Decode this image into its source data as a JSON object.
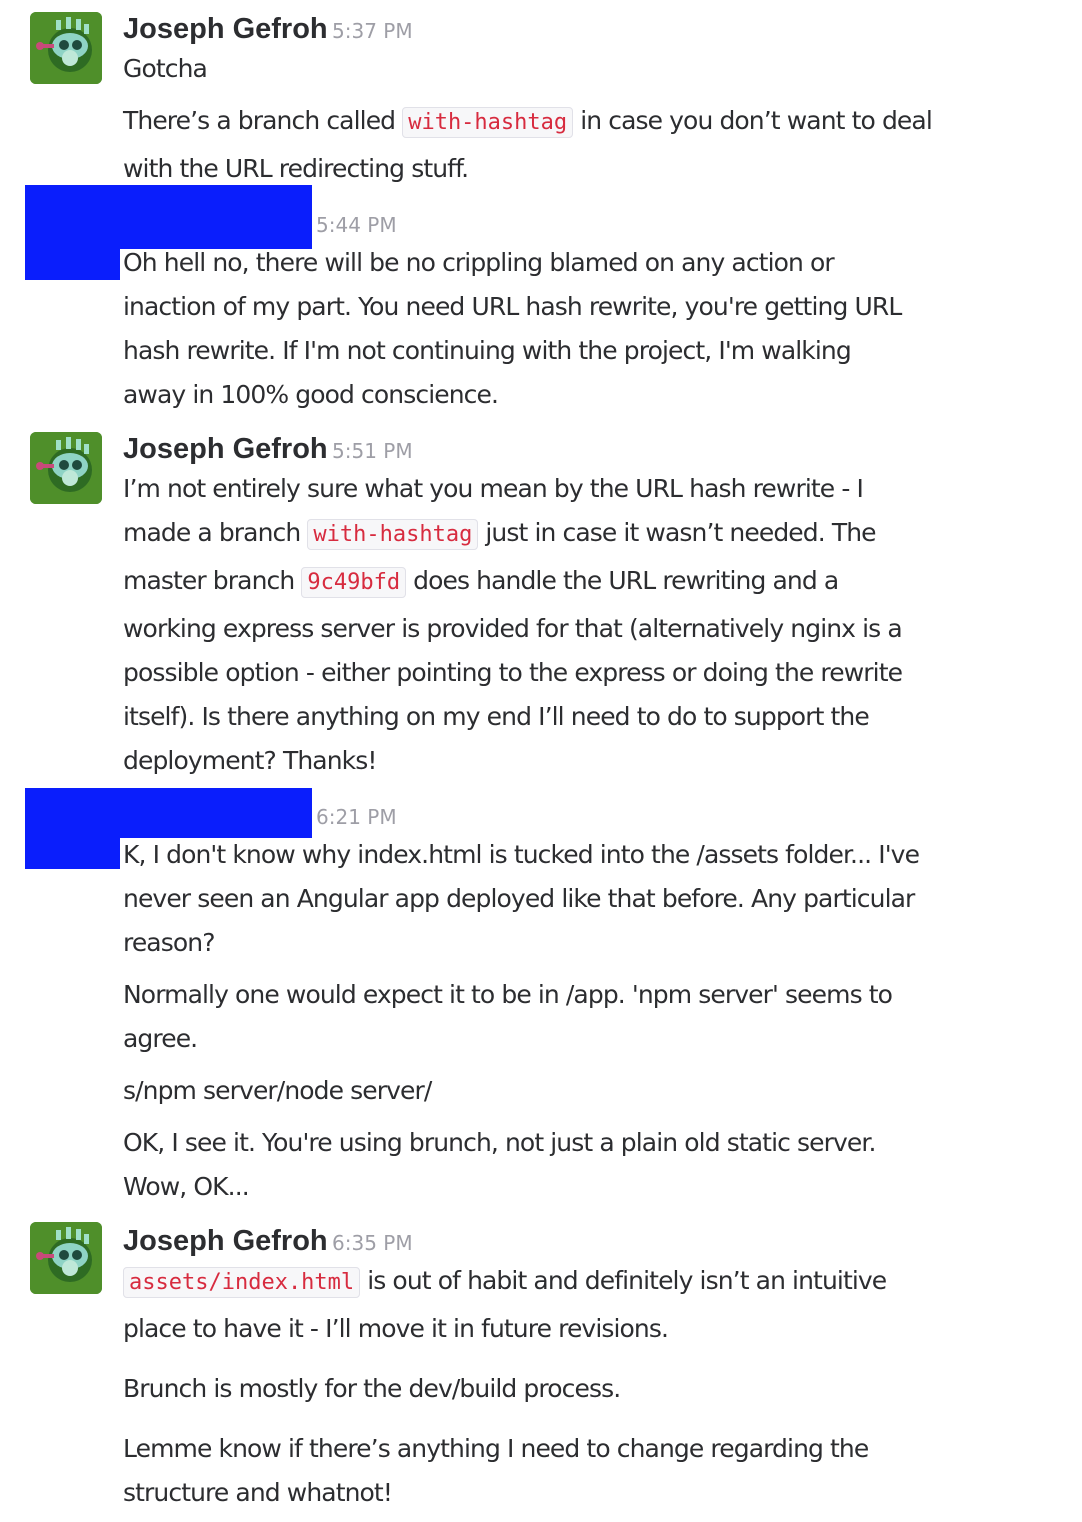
{
  "messages": [
    {
      "author": "Joseph Gefroh",
      "time": "5:37 PM",
      "lines": [
        "Gotcha",
        {
          "pre": "There’s a branch called ",
          "code": "with-hashtag",
          "post": " in case you don’t want to deal"
        },
        "with the URL redirecting stuff."
      ]
    },
    {
      "author": "",
      "time": "5:44 PM",
      "lines": [
        "Oh hell no, there will be no crippling blamed on any action or",
        "inaction of my part.  You need URL hash rewrite, you're getting URL",
        "hash rewrite.  If I'm not continuing with the project, I'm walking",
        "away in 100% good conscience."
      ]
    },
    {
      "author": "Joseph Gefroh",
      "time": "5:51 PM",
      "lines": [
        "I’m not entirely sure what you mean by the URL hash rewrite - I",
        {
          "pre": "made a branch ",
          "code": "with-hashtag",
          "post": " just in case it wasn’t needed. The"
        },
        {
          "pre": "master branch ",
          "code": "9c49bfd",
          "post": " does handle the URL rewriting and a"
        },
        "working express server is provided for that (alternatively nginx is a",
        "possible option - either pointing to the express or doing the rewrite",
        "itself). Is there anything on my end I’ll need to do to support the",
        "deployment? Thanks!"
      ]
    },
    {
      "author": "",
      "time": "6:21 PM",
      "lines": [
        "K, I don't know why index.html is tucked into the /assets folder... I've",
        "never seen an Angular app deployed like that before. Any particular",
        "reason?",
        "Normally one would expect it to be in /app.  'npm server' seems to",
        "agree.",
        "s/npm server/node server/",
        "OK, I see it.  You're using brunch, not just a plain old static server.",
        " Wow, OK..."
      ]
    },
    {
      "author": "Joseph Gefroh",
      "time": "6:35 PM",
      "lines": [
        {
          "pre": "",
          "code": "assets/index.html",
          "post": " is out of habit and definitely isn’t an intuitive"
        },
        "place to have it - I’ll move it in future revisions.",
        "Brunch is mostly for the dev/build process.",
        "Lemme know if there’s anything I need to change regarding the",
        "structure and whatnot!"
      ]
    }
  ]
}
